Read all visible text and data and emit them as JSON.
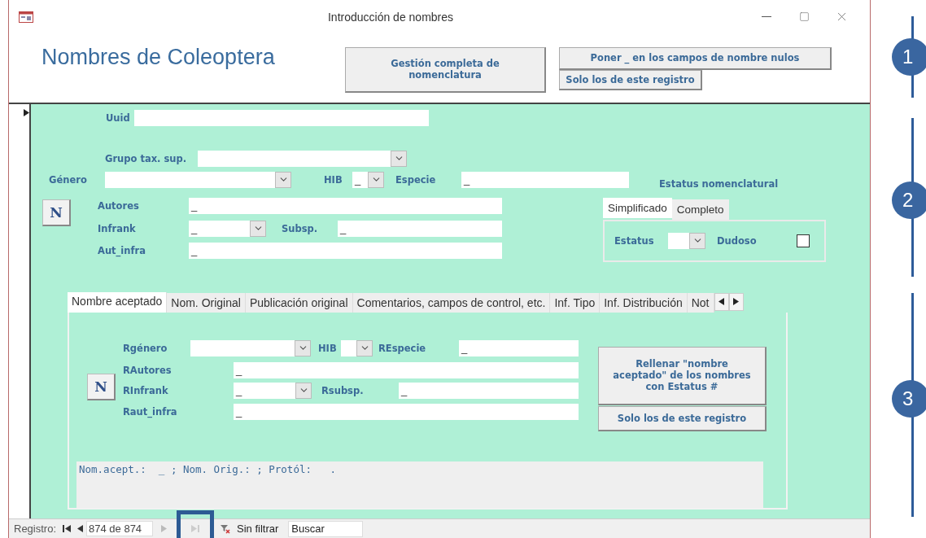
{
  "window": {
    "title": "Introducción de nombres"
  },
  "header": {
    "title": "Nombres de Coleoptera",
    "main_button": "Gestión completa de nomenclatura",
    "null_button": "Poner _ en los campos de nombre nulos",
    "record_button": "Solo los de este registro"
  },
  "form": {
    "uuid": {
      "label": "Uuid"
    },
    "grupo": {
      "label": "Grupo tax. sup."
    },
    "genero": {
      "label": "Género"
    },
    "hib": {
      "label": "HIB",
      "value": "_"
    },
    "especie": {
      "label": "Especie",
      "value": "_"
    },
    "status_title": "Estatus nomenclatural",
    "n_button": "N",
    "autores": {
      "label": "Autores",
      "value": "_"
    },
    "infrank": {
      "label": "Infrank",
      "value": "_"
    },
    "subsp": {
      "label": "Subsp.",
      "value": "_"
    },
    "aut_infra": {
      "label": "Aut_infra",
      "value": "_"
    },
    "status_tabs": [
      {
        "label": "Simplificado",
        "selected": true
      },
      {
        "label": "Completo",
        "selected": false
      }
    ],
    "estatus": {
      "label": "Estatus"
    },
    "dudoso": {
      "label": "Dudoso",
      "checked": false
    }
  },
  "tabs": [
    {
      "label": "Nombre aceptado",
      "selected": true
    },
    {
      "label": "Nom. Original",
      "selected": false
    },
    {
      "label": "Publicación original",
      "selected": false
    },
    {
      "label": "Comentarios, campos de control, etc.",
      "selected": false
    },
    {
      "label": "Inf. Tipo",
      "selected": false
    },
    {
      "label": "Inf. Distribución",
      "selected": false
    },
    {
      "label": "Not",
      "selected": false
    }
  ],
  "accepted": {
    "rgenero": {
      "label": "Rgénero"
    },
    "hib": {
      "label": "HIB"
    },
    "respecie": {
      "label": "REspecie",
      "value": "_"
    },
    "n_button": "N",
    "rautores": {
      "label": "RAutores",
      "value": "_"
    },
    "rinfrank": {
      "label": "RInfrank",
      "value": "_"
    },
    "rsubsp": {
      "label": "Rsubsp.",
      "value": "_"
    },
    "raut_infra": {
      "label": "Raut_infra",
      "value": "_"
    },
    "fill_button": "Rellenar \"nombre aceptado\" de los nombres con Estatus  #",
    "record_button": "Solo los de este registro",
    "summary": "Nom.acept.:  _ ; Nom. Orig.: ; Protól:   ."
  },
  "status_bar": {
    "label": "Registro:",
    "record": "874 de 874",
    "filter": "Sin filtrar",
    "search": {
      "placeholder": "Buscar"
    }
  },
  "markers": [
    "1",
    "2",
    "3"
  ]
}
